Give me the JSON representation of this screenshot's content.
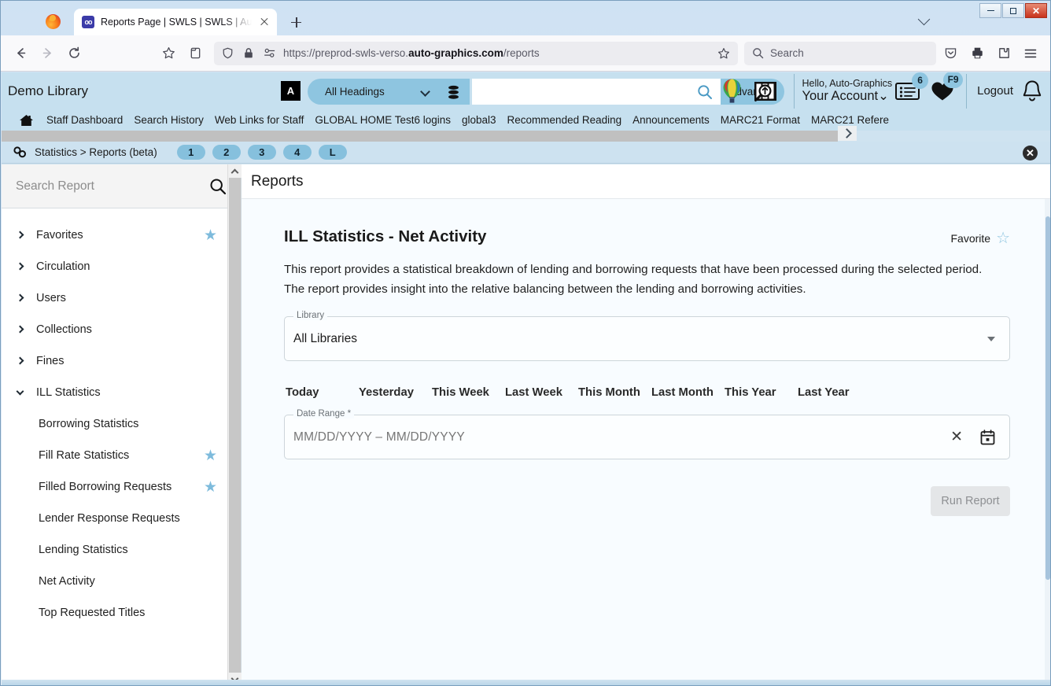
{
  "browser": {
    "tab": {
      "title": "Reports Page | SWLS | SWLS | Au",
      "favicon_icon": "app-favicon"
    },
    "new_tab_icon": "plus-icon",
    "tab_list_icon": "chevron-down-icon",
    "window_controls": {
      "minimize": "minimize-icon",
      "maximize": "maximize-icon",
      "close": "close-icon"
    },
    "nav": {
      "back_icon": "back-arrow-icon",
      "forward_icon": "forward-arrow-icon",
      "reload_icon": "reload-icon",
      "bookmark_icon": "star-icon",
      "save_to_pocket_icon": "pocket-save-icon",
      "shield_icon": "shield-icon",
      "lock_icon": "lock-icon",
      "permissions_icon": "permissions-icon",
      "url_prefix": "https://preprod-swls-verso.",
      "url_domain": "auto-graphics.com",
      "url_suffix": "/reports",
      "star_icon": "bookmark-star-icon",
      "search_placeholder": "Search",
      "search_icon": "search-icon",
      "pocket_icon": "pocket-icon",
      "print_icon": "print-icon",
      "extension_icon": "extension-icon",
      "menu_icon": "hamburger-menu-icon"
    }
  },
  "app_header": {
    "library_name": "Demo Library",
    "scan_icon": "barcode-a-icon",
    "headings_select": "All Headings",
    "headings_chevron_icon": "chevron-down-icon",
    "database_icon": "database-icon",
    "search_value": "",
    "search_icon": "search-icon",
    "advanced_label": "Advanced",
    "balloon_icon": "hot-air-balloon-icon",
    "magnify_record_icon": "magnify-record-icon",
    "list_icon": "list-icon",
    "list_badge": "6",
    "heart_icon": "heart-icon",
    "heart_badge": "F9",
    "bell_icon": "bell-icon",
    "greeting": "Hello, Auto-Graphics",
    "account_label": "Your Account",
    "account_chevron_icon": "chevron-down-icon",
    "logout_label": "Logout"
  },
  "nav_menu": {
    "home_icon": "home-icon",
    "items": [
      "Staff Dashboard",
      "Search History",
      "Web Links for Staff",
      "GLOBAL HOME Test6 logins",
      "global3",
      "Recommended Reading",
      "Announcements",
      "MARC21 Format",
      "MARC21 Refere"
    ],
    "overflow_icon": "chevron-right-icon"
  },
  "stat_bar": {
    "link_icon": "chain-link-icon",
    "breadcrumb": "Statistics > Reports (beta)",
    "pills": [
      "1",
      "2",
      "3",
      "4",
      "L"
    ],
    "close_icon": "close-circle-icon"
  },
  "sidebar": {
    "search_placeholder": "Search Report",
    "search_icon": "search-icon",
    "tree": [
      {
        "label": "Favorites",
        "expanded": false,
        "favorite": true,
        "level": 0
      },
      {
        "label": "Circulation",
        "expanded": false,
        "favorite": false,
        "level": 0
      },
      {
        "label": "Users",
        "expanded": false,
        "favorite": false,
        "level": 0
      },
      {
        "label": "Collections",
        "expanded": false,
        "favorite": false,
        "level": 0
      },
      {
        "label": "Fines",
        "expanded": false,
        "favorite": false,
        "level": 0
      },
      {
        "label": "ILL Statistics",
        "expanded": true,
        "favorite": false,
        "level": 0
      },
      {
        "label": "Borrowing Statistics",
        "expanded": null,
        "favorite": false,
        "level": 1
      },
      {
        "label": "Fill Rate Statistics",
        "expanded": null,
        "favorite": true,
        "level": 1
      },
      {
        "label": "Filled Borrowing Requests",
        "expanded": null,
        "favorite": true,
        "level": 1
      },
      {
        "label": "Lender Response Requests",
        "expanded": null,
        "favorite": false,
        "level": 1
      },
      {
        "label": "Lending Statistics",
        "expanded": null,
        "favorite": false,
        "level": 1
      },
      {
        "label": "Net Activity",
        "expanded": null,
        "favorite": false,
        "level": 1
      },
      {
        "label": "Top Requested Titles",
        "expanded": null,
        "favorite": false,
        "level": 1
      }
    ],
    "scroll_up_icon": "chevron-up-icon",
    "scroll_down_icon": "chevron-down-icon"
  },
  "main": {
    "page_title": "Reports",
    "report_title": "ILL Statistics - Net Activity",
    "favorite_label": "Favorite",
    "favorite_star_icon": "star-outline-icon",
    "description": "This report provides a statistical breakdown of lending and borrowing requests that have been processed during the selected period. The report provides insight into the relative balancing between the lending and borrowing activities.",
    "library_field": {
      "legend": "Library",
      "value": "All Libraries",
      "chevron_icon": "caret-down-icon"
    },
    "quick_ranges": [
      "Today",
      "Yesterday",
      "This Week",
      "Last Week",
      "This Month",
      "Last Month",
      "This Year",
      "Last Year"
    ],
    "date_range_field": {
      "legend": "Date Range *",
      "placeholder": "MM/DD/YYYY – MM/DD/YYYY",
      "value": "",
      "clear_icon": "close-x-icon",
      "calendar_icon": "calendar-icon"
    },
    "run_button": {
      "label": "Run Report",
      "disabled": true
    }
  },
  "colors": {
    "header_blue": "#c6e0ef",
    "accent_blue": "#8ec5e0",
    "star_blue": "#7ebbdc",
    "close_red": "#c8331c"
  }
}
